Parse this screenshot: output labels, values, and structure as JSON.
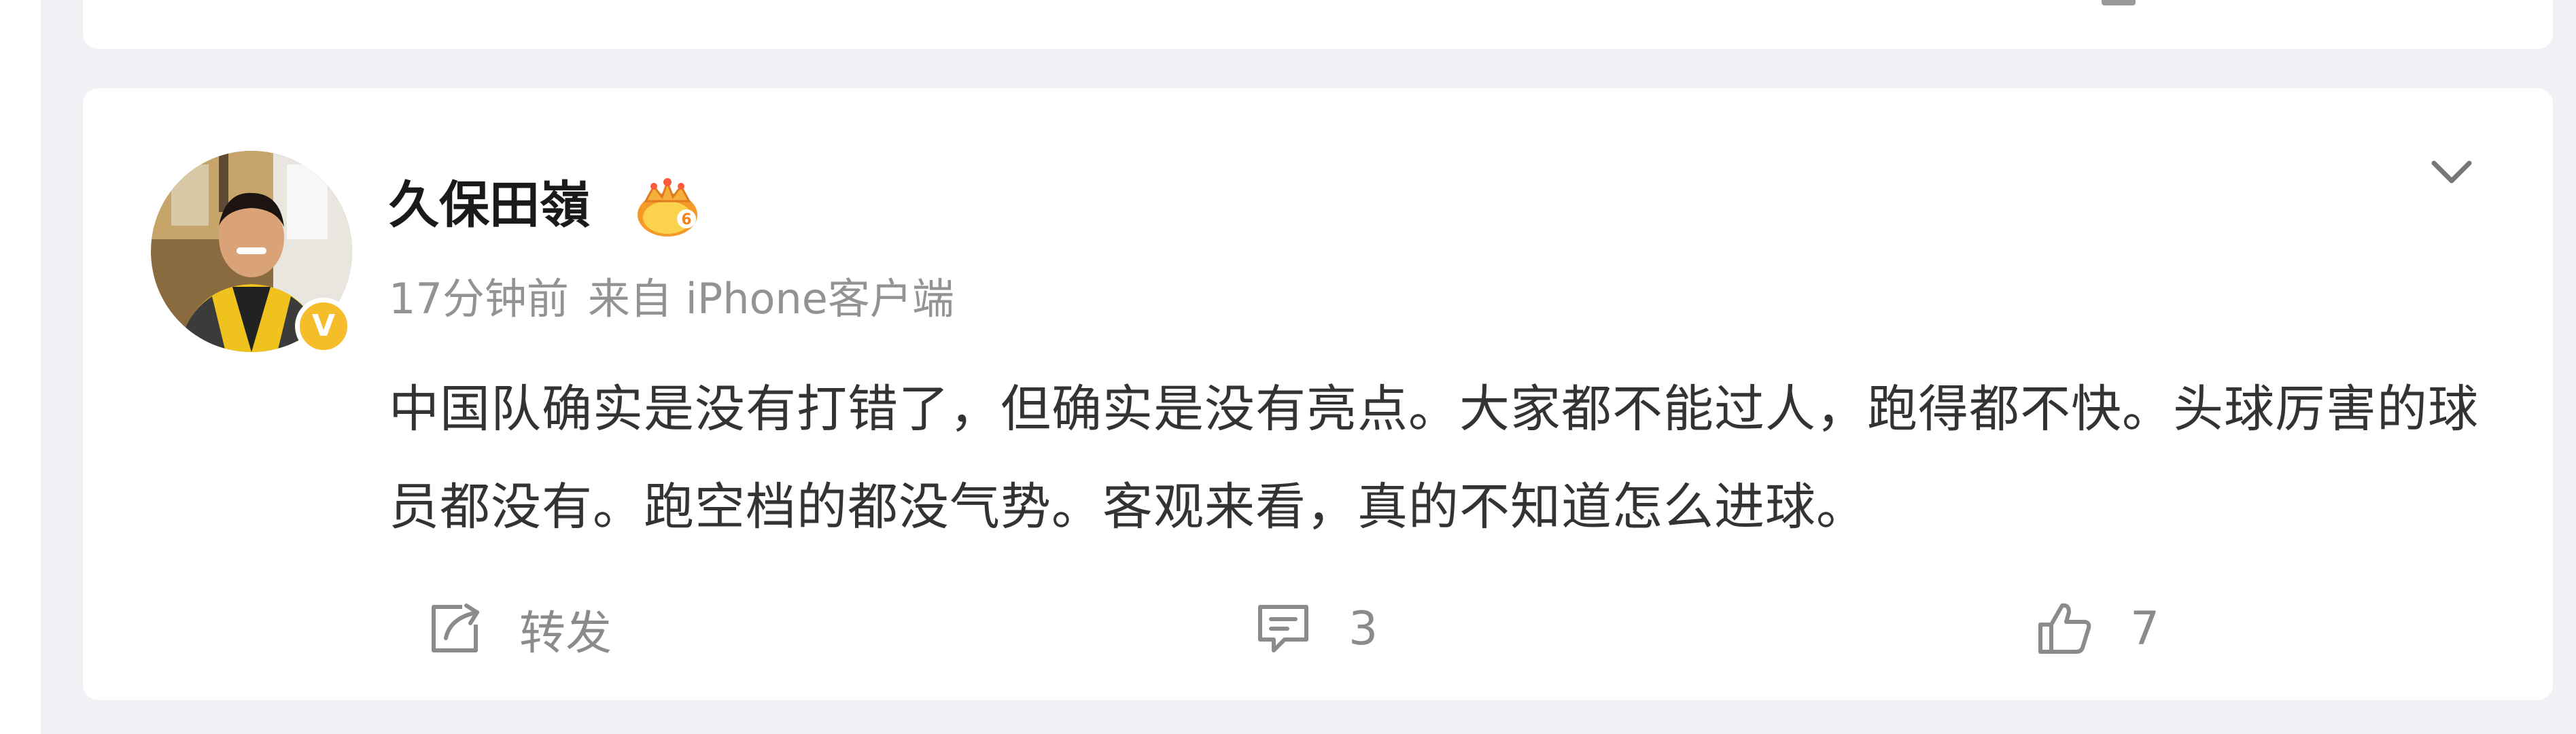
{
  "post": {
    "author": {
      "name": "久保田嶺",
      "avatar_icon": "avatar-photo",
      "verified_icon": "verified-badge-icon",
      "verified_mark": "V",
      "member_icon": "member-crown-icon"
    },
    "time": "17分钟前",
    "source": "来自 iPhone客户端",
    "text": "中国队确实是没有打错了，但确实是没有亮点。大家都不能过人，跑得都不快。头球厉害的球员都没有。跑空档的都没气势。客观来看，真的不知道怎么进球。",
    "menu_icon": "chevron-down-icon",
    "actions": {
      "forward": {
        "icon": "share-icon",
        "label": "转发"
      },
      "comment": {
        "icon": "comment-icon",
        "count": "3"
      },
      "like": {
        "icon": "thumbs-up-icon",
        "count": "7"
      }
    }
  },
  "colors": {
    "background": "#f0f1f4",
    "card": "#ffffff",
    "name": "#1a1a1a",
    "meta": "#939393",
    "text": "#333333",
    "action": "#8b8b8b",
    "verified": "#f5bd2a"
  }
}
